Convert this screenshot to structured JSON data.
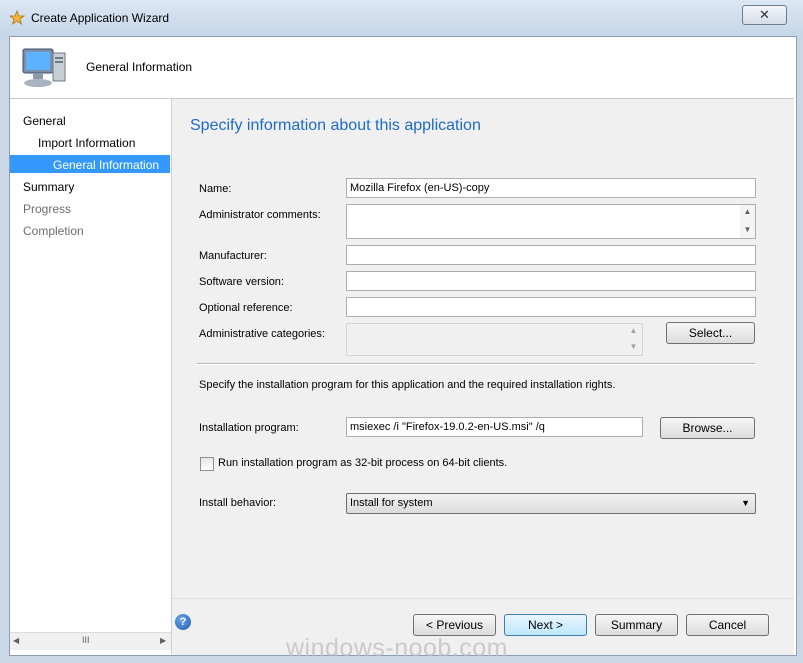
{
  "window": {
    "title": "Create Application Wizard",
    "close_label": "✕"
  },
  "header": {
    "title": "General Information"
  },
  "sidebar": {
    "items": [
      {
        "label": "General",
        "state": "active"
      },
      {
        "label": "Import Information",
        "state": "active"
      },
      {
        "label": "General Information",
        "state": "selected"
      },
      {
        "label": "Summary",
        "state": "active"
      },
      {
        "label": "Progress",
        "state": "disabled"
      },
      {
        "label": "Completion",
        "state": "disabled"
      }
    ],
    "scroll_grip": "III"
  },
  "main": {
    "heading": "Specify information about this application",
    "fields": {
      "name": {
        "label": "Name:",
        "value": "Mozilla Firefox (en-US)-copy"
      },
      "admin_comments": {
        "label": "Administrator comments:",
        "value": ""
      },
      "manufacturer": {
        "label": "Manufacturer:",
        "value": ""
      },
      "software_version": {
        "label": "Software version:",
        "value": ""
      },
      "optional_reference": {
        "label": "Optional reference:",
        "value": ""
      },
      "admin_categories": {
        "label": "Administrative categories:",
        "value": ""
      }
    },
    "select_button": "Select...",
    "install_section_text": "Specify the installation program for this application and the required installation rights.",
    "installation_program": {
      "label": "Installation program:",
      "value": "msiexec /i \"Firefox-19.0.2-en-US.msi\" /q"
    },
    "browse_button": "Browse...",
    "run32_checkbox": {
      "label": "Run installation program as 32-bit process on 64-bit clients.",
      "checked": false
    },
    "install_behavior": {
      "label": "Install behavior:",
      "value": "Install for system"
    }
  },
  "footer": {
    "previous": "< Previous",
    "next": "Next >",
    "summary": "Summary",
    "cancel": "Cancel",
    "help_glyph": "?"
  },
  "watermark": "windows-noob.com",
  "colors": {
    "heading": "#1e6cc6",
    "selection": "#3399ff",
    "disabled_text": "#6d6d6d"
  }
}
